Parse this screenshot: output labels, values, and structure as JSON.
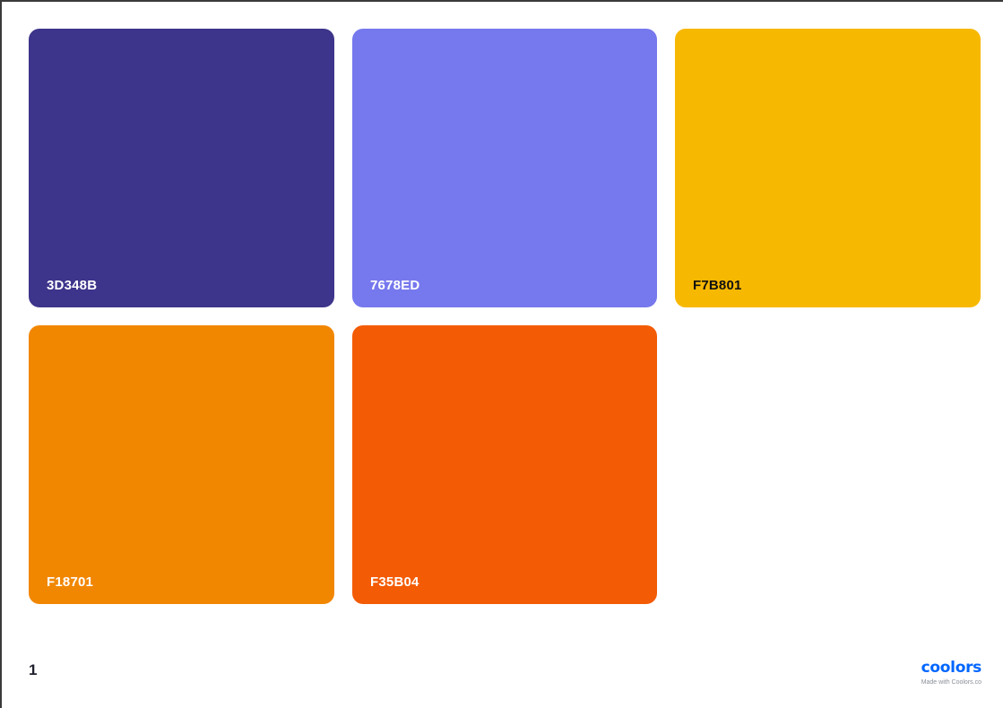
{
  "palette": {
    "swatches": [
      {
        "hex": "3D348B",
        "color": "#3D348B",
        "text_color": "#ffffff"
      },
      {
        "hex": "7678ED",
        "color": "#7678ED",
        "text_color": "#ffffff"
      },
      {
        "hex": "F7B801",
        "color": "#F7B801",
        "text_color": "#111111"
      },
      {
        "hex": "F18701",
        "color": "#F18701",
        "text_color": "#ffffff"
      },
      {
        "hex": "F35B04",
        "color": "#F35B04",
        "text_color": "#ffffff"
      }
    ]
  },
  "footer": {
    "page_number": "1",
    "brand_logo": "coolors",
    "brand_tagline": "Made with Coolors.co",
    "brand_color": "#0066FF"
  }
}
